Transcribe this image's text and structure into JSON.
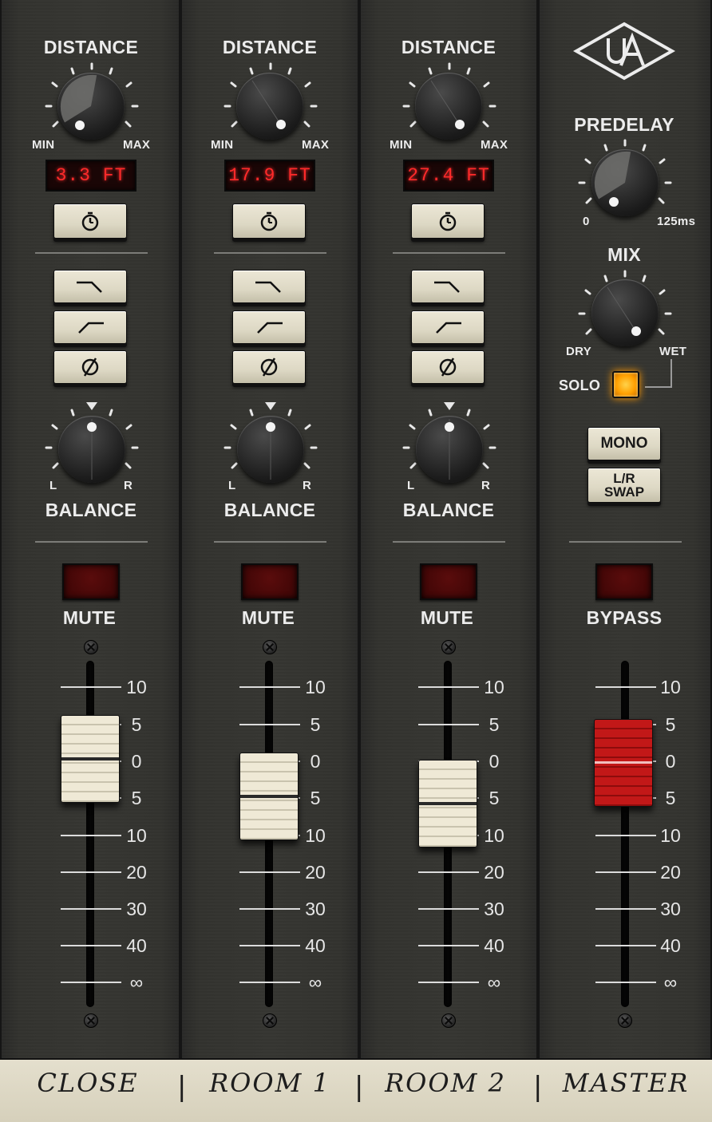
{
  "channels": [
    {
      "distance_label": "DISTANCE",
      "min_label": "MIN",
      "max_label": "MAX",
      "distance_display": "3.3 FT",
      "balance_label": "BALANCE",
      "bal_l": "L",
      "bal_r": "R",
      "mute_label": "MUTE",
      "scribble": "CLOSE"
    },
    {
      "distance_label": "DISTANCE",
      "min_label": "MIN",
      "max_label": "MAX",
      "distance_display": "17.9 FT",
      "balance_label": "BALANCE",
      "bal_l": "L",
      "bal_r": "R",
      "mute_label": "MUTE",
      "scribble": "ROOM 1"
    },
    {
      "distance_label": "DISTANCE",
      "min_label": "MIN",
      "max_label": "MAX",
      "distance_display": "27.4 FT",
      "balance_label": "BALANCE",
      "bal_l": "L",
      "bal_r": "R",
      "mute_label": "MUTE",
      "scribble": "ROOM 2"
    }
  ],
  "master": {
    "predelay_label": "PREDELAY",
    "predelay_min": "0",
    "predelay_max": "125ms",
    "mix_label": "MIX",
    "mix_min": "DRY",
    "mix_max": "WET",
    "solo_label": "SOLO",
    "mono_label": "MONO",
    "lr_swap_line1": "L/R",
    "lr_swap_line2": "SWAP",
    "bypass_label": "BYPASS",
    "scribble": "MASTER"
  },
  "fader_scale": [
    "10",
    "5",
    "0",
    "5",
    "10",
    "20",
    "30",
    "40",
    "∞"
  ],
  "icons": {
    "logo": "universal-audio-logo-icon",
    "sync": "timer-icon",
    "lowpass": "low-pass-filter-icon",
    "highpass": "high-pass-filter-icon",
    "phase": "phase-invert-icon"
  },
  "colors": {
    "display_text": "#ff2a2a",
    "solo_led": "#ffa000",
    "master_fader": "#c21818",
    "channel_fader": "#efe9d6"
  }
}
